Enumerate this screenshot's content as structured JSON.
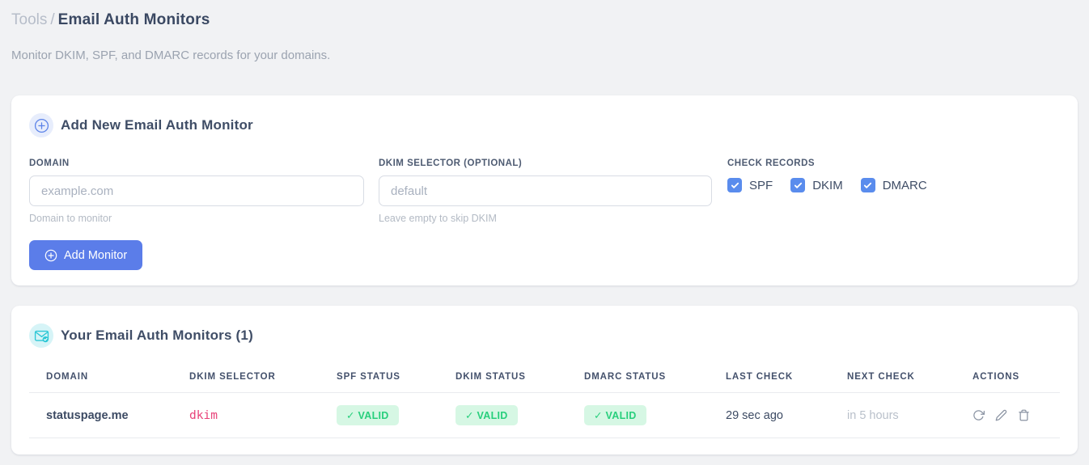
{
  "breadcrumb": {
    "section": "Tools",
    "separator": "/",
    "page": "Email Auth Monitors"
  },
  "subtitle": "Monitor DKIM, SPF, and DMARC records for your domains.",
  "colors": {
    "accent_blue": "#5b7de9",
    "checkbox_blue": "#5a8ced",
    "accent_teal": "#2cc7d5",
    "valid_bg": "#d6f7e4",
    "valid_text": "#28cf7c",
    "code_pink": "#e8437a"
  },
  "icons": {
    "add_card": "plus-circle-icon",
    "monitors_card": "envelope-check-icon",
    "row_actions": [
      "refresh-icon",
      "edit-icon",
      "trash-icon"
    ]
  },
  "add_card": {
    "title": "Add New Email Auth Monitor",
    "domain_field": {
      "label": "DOMAIN",
      "placeholder": "example.com",
      "value": "",
      "help": "Domain to monitor"
    },
    "dkim_field": {
      "label": "DKIM SELECTOR (OPTIONAL)",
      "placeholder": "default",
      "value": "",
      "help": "Leave empty to skip DKIM"
    },
    "check_records": {
      "label": "CHECK RECORDS",
      "options": [
        {
          "label": "SPF",
          "checked": true
        },
        {
          "label": "DKIM",
          "checked": true
        },
        {
          "label": "DMARC",
          "checked": true
        }
      ]
    },
    "submit_label": "Add Monitor"
  },
  "monitors_card": {
    "title": "Your Email Auth Monitors (1)",
    "count": 1,
    "table": {
      "headers": [
        "DOMAIN",
        "DKIM SELECTOR",
        "SPF STATUS",
        "DKIM STATUS",
        "DMARC STATUS",
        "LAST CHECK",
        "NEXT CHECK",
        "ACTIONS"
      ],
      "rows": [
        {
          "domain": "statuspage.me",
          "dkim_selector": "dkim",
          "spf_status": "✓ VALID",
          "dkim_status": "✓ VALID",
          "dmarc_status": "✓ VALID",
          "last_check": "29 sec ago",
          "next_check": "in 5 hours"
        }
      ]
    }
  }
}
